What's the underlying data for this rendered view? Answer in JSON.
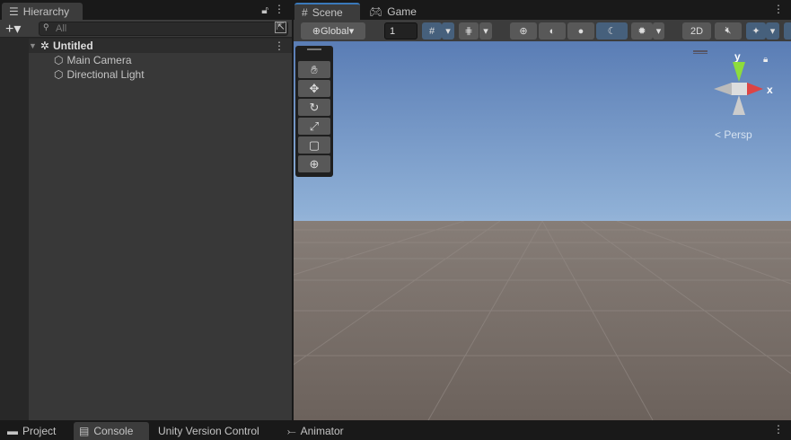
{
  "hierarchy": {
    "tab_label": "Hierarchy",
    "search_placeholder": "All",
    "scene_name": "Untitled",
    "objects": [
      {
        "label": "Main Camera"
      },
      {
        "label": "Directional Light"
      }
    ]
  },
  "scene": {
    "tabs": [
      {
        "label": "Scene"
      },
      {
        "label": "Game"
      }
    ],
    "pivot_label": "Global",
    "grid_value": "1",
    "mode_2d": "2D",
    "persp_label": "< Persp",
    "axis_y": "y",
    "axis_x": "x"
  },
  "bottom": {
    "tabs": [
      {
        "label": "Project"
      },
      {
        "label": "Console"
      },
      {
        "label": "Unity Version Control"
      },
      {
        "label": "Animator"
      }
    ]
  }
}
